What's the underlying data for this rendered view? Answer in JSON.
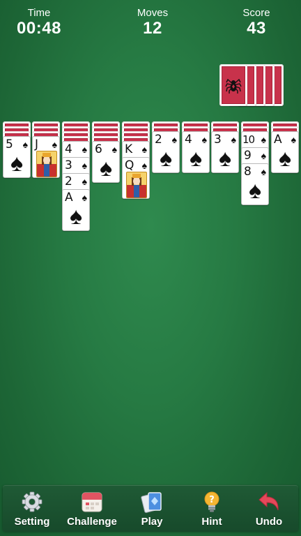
{
  "status": {
    "time_label": "Time",
    "time_value": "00:48",
    "moves_label": "Moves",
    "moves_value": "12",
    "score_label": "Score",
    "score_value": "43"
  },
  "stock": {
    "remaining_deals": 5
  },
  "colors": {
    "felt": "#267a43",
    "card_back": "#c8324b",
    "toolbar": "#1c5231"
  },
  "tableau": [
    {
      "facedown": 3,
      "faceup": [
        {
          "rank": "5",
          "suit": "♠",
          "large": "♠"
        }
      ]
    },
    {
      "facedown": 3,
      "faceup": [
        {
          "rank": "J",
          "suit": "♠",
          "face": "jack"
        }
      ]
    },
    {
      "facedown": 4,
      "faceup": [
        {
          "rank": "4",
          "suit": "♠"
        },
        {
          "rank": "3",
          "suit": "♠"
        },
        {
          "rank": "2",
          "suit": "♠"
        },
        {
          "rank": "A",
          "suit": "♠",
          "large": "♠"
        }
      ]
    },
    {
      "facedown": 4,
      "faceup": [
        {
          "rank": "6",
          "suit": "♠",
          "large": "♠"
        }
      ]
    },
    {
      "facedown": 4,
      "faceup": [
        {
          "rank": "K",
          "suit": "♠"
        },
        {
          "rank": "Q",
          "suit": "♠",
          "face": "queen"
        }
      ]
    },
    {
      "facedown": 2,
      "faceup": [
        {
          "rank": "2",
          "suit": "♠",
          "large": "♠"
        }
      ]
    },
    {
      "facedown": 2,
      "faceup": [
        {
          "rank": "4",
          "suit": "♠",
          "large": "♠"
        }
      ]
    },
    {
      "facedown": 2,
      "faceup": [
        {
          "rank": "3",
          "suit": "♠",
          "large": "♠"
        }
      ]
    },
    {
      "facedown": 2,
      "faceup": [
        {
          "rank": "10",
          "suit": "♠"
        },
        {
          "rank": "9",
          "suit": "♠"
        },
        {
          "rank": "8",
          "suit": "♠",
          "large": "♠"
        }
      ]
    },
    {
      "facedown": 2,
      "faceup": [
        {
          "rank": "A",
          "suit": "♠",
          "large": "♠"
        }
      ]
    }
  ],
  "toolbar": {
    "setting_label": "Setting",
    "challenge_label": "Challenge",
    "play_label": "Play",
    "hint_label": "Hint",
    "undo_label": "Undo",
    "icons": [
      "gear-icon",
      "calendar-icon",
      "cards-icon",
      "lightbulb-icon",
      "undo-arrow-icon"
    ]
  }
}
